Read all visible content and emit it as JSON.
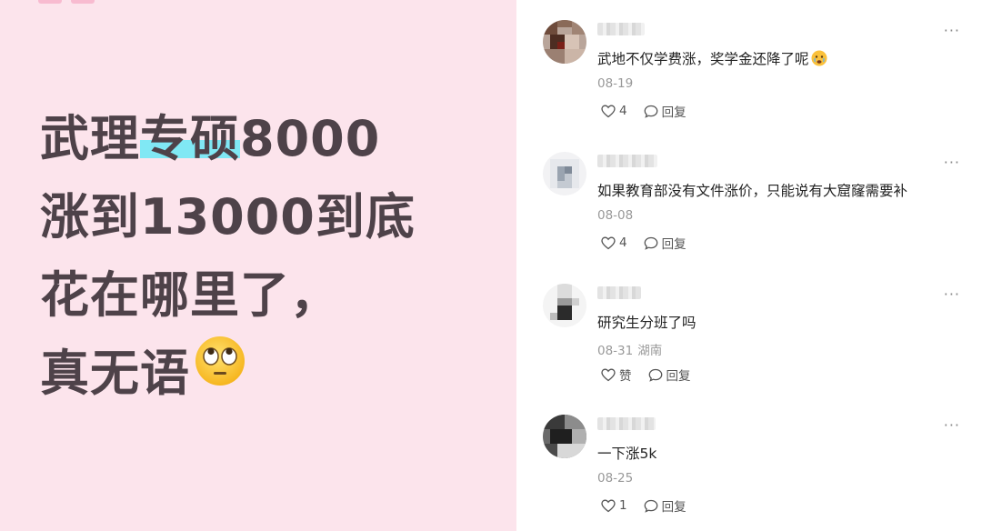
{
  "post": {
    "headline_lines": [
      {
        "pre": "武理",
        "hl": "专硕",
        "post": "8000"
      },
      {
        "pre": "涨到13000到底",
        "hl": "",
        "post": ""
      },
      {
        "pre": "花在哪里了，",
        "hl": "",
        "post": ""
      },
      {
        "pre": "真无语",
        "hl": "",
        "post": ""
      }
    ],
    "emoji": "face-with-rolling-eyes-emoji",
    "colors": {
      "background": "#fce4ec",
      "text": "#4e4249",
      "highlight": "#80e8f4"
    }
  },
  "comments": [
    {
      "username": "",
      "text": "武地不仅学费涨，奖学金还降了呢",
      "emoji": "crying-face-emoji",
      "date": "08-19",
      "location": "",
      "likes": "4",
      "reply_label": "回复",
      "more": "···"
    },
    {
      "username": "",
      "text": "如果教育部没有文件涨价，只能说有大窟窿需要补",
      "emoji": "",
      "date": "08-08",
      "location": "",
      "likes": "4",
      "reply_label": "回复",
      "more": "···"
    },
    {
      "username": "",
      "text": "研究生分班了吗",
      "emoji": "",
      "date": "08-31",
      "location": "湖南",
      "likes": "赞",
      "reply_label": "回复",
      "more": "···"
    },
    {
      "username": "",
      "text": "一下涨5k",
      "emoji": "",
      "date": "08-25",
      "location": "",
      "likes": "1",
      "reply_label": "回复",
      "more": "···"
    }
  ]
}
